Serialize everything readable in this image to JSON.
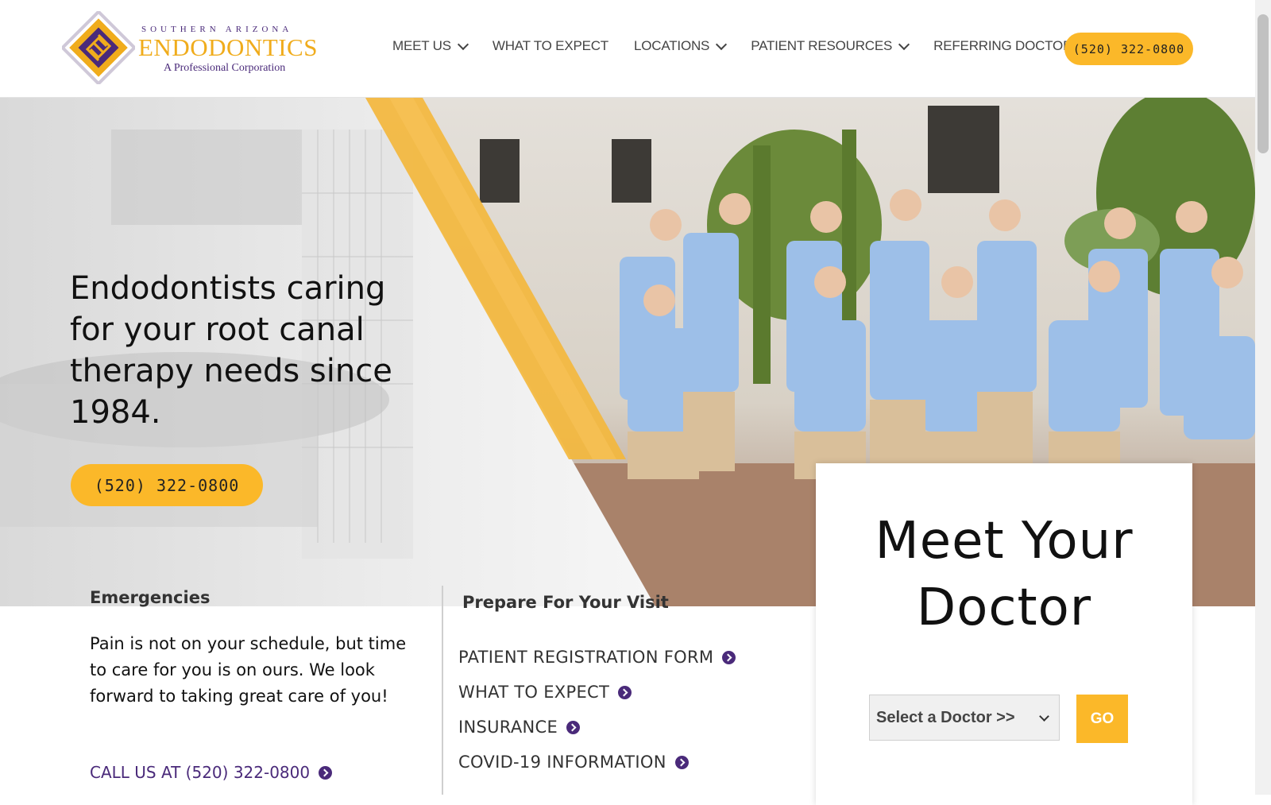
{
  "logo": {
    "line1": "SOUTHERN ARIZONA",
    "line2": "ENDODONTICS",
    "line3": "A Professional Corporation"
  },
  "nav": {
    "items": [
      {
        "label": "MEET US",
        "dropdown": true
      },
      {
        "label": "WHAT TO EXPECT",
        "dropdown": false
      },
      {
        "label": "LOCATIONS",
        "dropdown": true
      },
      {
        "label": "PATIENT RESOURCES",
        "dropdown": true
      },
      {
        "label": "REFERRING DOCTORS",
        "dropdown": false
      }
    ],
    "phone": "(520) 322-0800"
  },
  "hero": {
    "title": "Endodontists caring for your root canal therapy needs since 1984.",
    "phone": "(520) 322-0800"
  },
  "emergencies": {
    "heading": "Emergencies",
    "text": "Pain is not on your schedule, but time to care for you is on ours. We look forward to taking great care of you!",
    "call_link": "CALL US AT (520) 322-0800"
  },
  "prepare": {
    "heading": "Prepare For Your Visit",
    "links": [
      "PATIENT REGISTRATION FORM",
      "WHAT TO EXPECT",
      "INSURANCE",
      "COVID-19 INFORMATION"
    ]
  },
  "meet_doctor": {
    "title": "Meet Your Doctor",
    "select_value": "Select a Doctor >>",
    "go_label": "GO"
  },
  "colors": {
    "accent_gold": "#fbb829",
    "brand_purple": "#4a2a7a"
  },
  "icons": [
    "chevron-down-icon",
    "arrow-circle-icon",
    "logo-mark-icon"
  ]
}
